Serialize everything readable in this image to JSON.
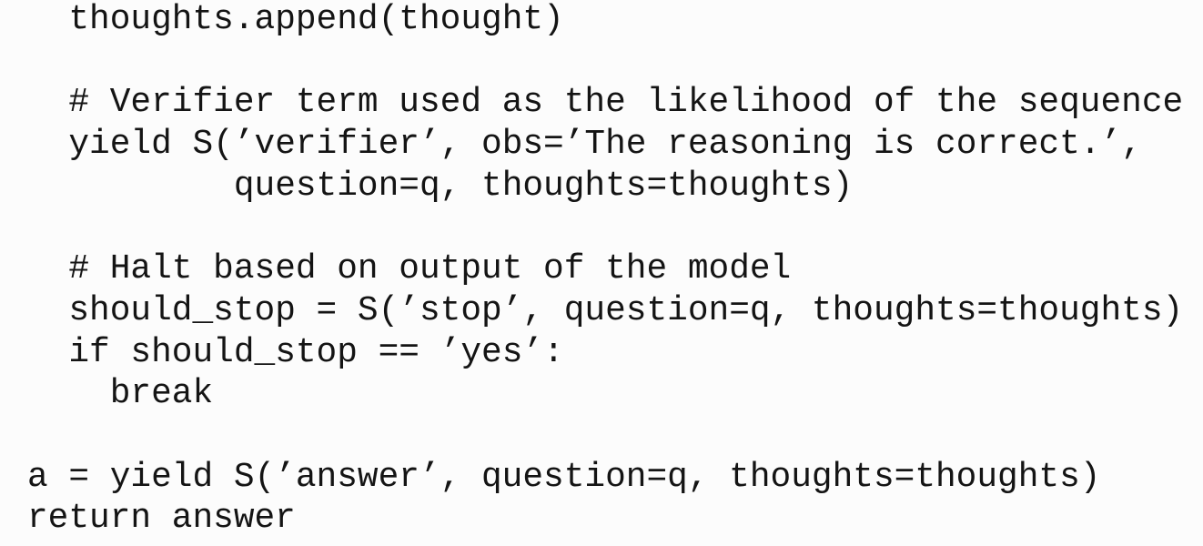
{
  "code": {
    "language": "python",
    "lines": [
      {
        "indent": "  ",
        "text": "thoughts.append(thought)",
        "kind": "statement"
      },
      {
        "indent": "",
        "text": "",
        "kind": "blank"
      },
      {
        "indent": "  ",
        "text": "# Verifier term used as the likelihood of the sequence",
        "kind": "comment"
      },
      {
        "indent": "  ",
        "text": "yield S(’verifier’, obs=’The reasoning is correct.’,",
        "kind": "statement"
      },
      {
        "indent": "          ",
        "text": "question=q, thoughts=thoughts)",
        "kind": "statement"
      },
      {
        "indent": "",
        "text": "",
        "kind": "blank"
      },
      {
        "indent": "  ",
        "text": "# Halt based on output of the model",
        "kind": "comment"
      },
      {
        "indent": "  ",
        "text": "should_stop = S(’stop’, question=q, thoughts=thoughts)",
        "kind": "statement"
      },
      {
        "indent": "  ",
        "text": "if should_stop == ’yes’:",
        "kind": "statement"
      },
      {
        "indent": "    ",
        "text": "break",
        "kind": "statement"
      },
      {
        "indent": "",
        "text": "",
        "kind": "blank"
      },
      {
        "indent": "",
        "text": "a = yield S(’answer’, question=q, thoughts=thoughts)",
        "kind": "statement"
      },
      {
        "indent": "",
        "text": "return answer",
        "kind": "statement"
      }
    ]
  },
  "colors": {
    "background": "#fcfcfc",
    "text": "#141414"
  }
}
